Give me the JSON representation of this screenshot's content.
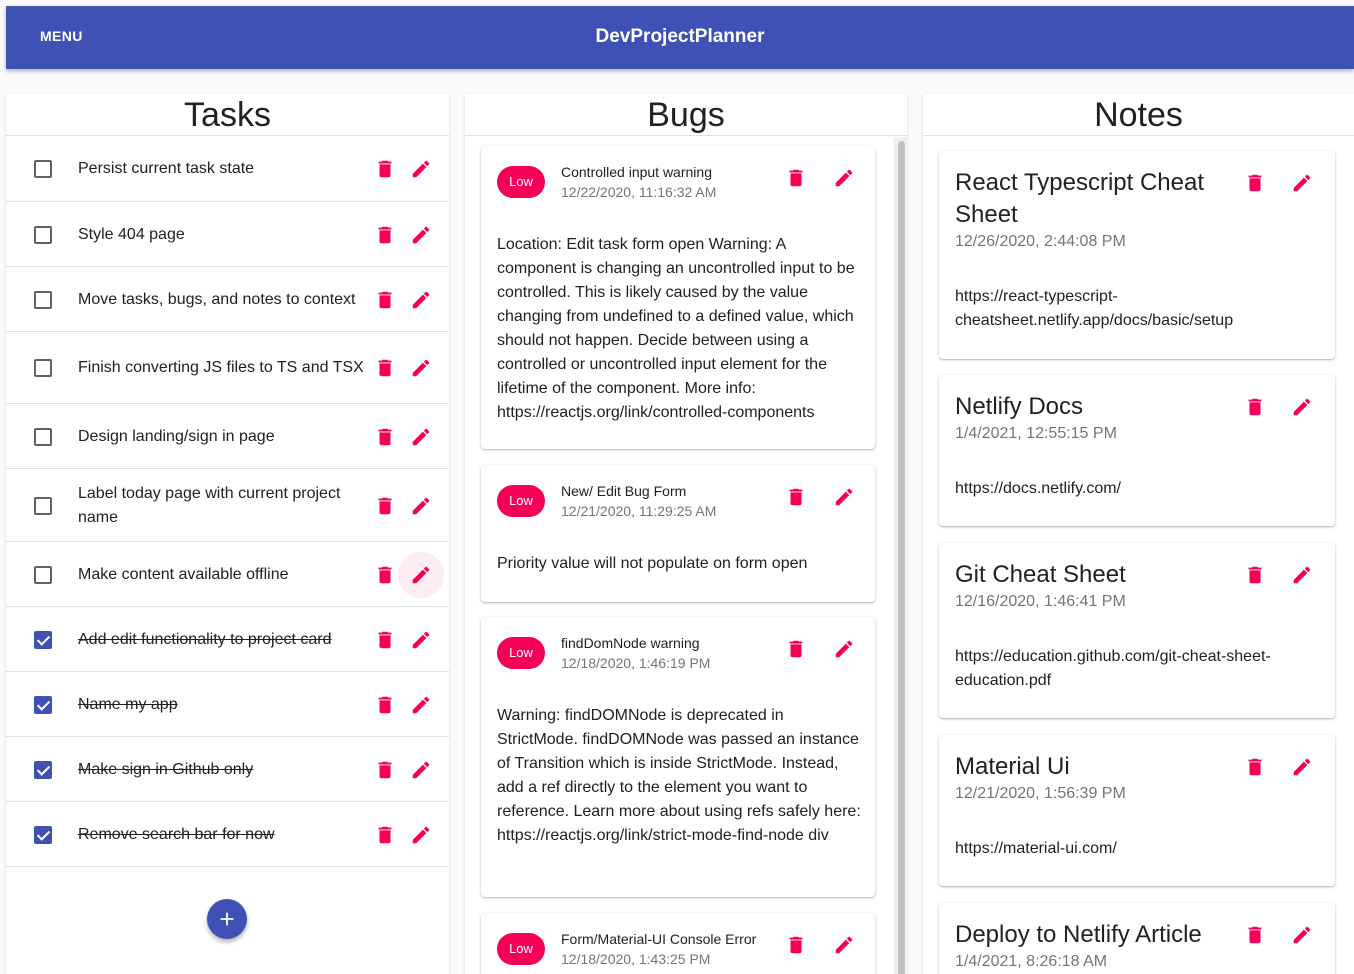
{
  "app": {
    "menu_label": "MENU",
    "title": "DevProjectPlanner"
  },
  "colors": {
    "primary": "#3f51b5",
    "secondary": "#f50057"
  },
  "tasks": {
    "title": "Tasks",
    "items": [
      {
        "text": "Persist current task state",
        "done": false
      },
      {
        "text": "Style 404 page",
        "done": false
      },
      {
        "text": "Move tasks, bugs, and notes to context",
        "done": false
      },
      {
        "text": "Finish converting JS files to TS and TSX",
        "done": false
      },
      {
        "text": "Design landing/sign in page",
        "done": false
      },
      {
        "text": "Label today page with current project name",
        "done": false
      },
      {
        "text": "Make content available offline",
        "done": false
      },
      {
        "text": "Add edit functionality to project card",
        "done": true
      },
      {
        "text": "Name my app",
        "done": true
      },
      {
        "text": "Make sign in Github only",
        "done": true
      },
      {
        "text": "Remove search bar for now",
        "done": true
      }
    ]
  },
  "bugs": {
    "title": "Bugs",
    "items": [
      {
        "priority": "Low",
        "title": "Controlled input warning",
        "date": "12/22/2020, 11:16:32 AM",
        "body": "Location: Edit task form open Warning: A component is changing an uncontrolled input to be controlled. This is likely caused by the value changing from undefined to a defined value, which should not happen. Decide between using a controlled or uncontrolled input element for the lifetime of the component. More info: https://reactjs.org/link/controlled-components"
      },
      {
        "priority": "Low",
        "title": "New/ Edit Bug Form",
        "date": "12/21/2020, 11:29:25 AM",
        "body": "Priority value will not populate on form open"
      },
      {
        "priority": "Low",
        "title": "findDomNode warning",
        "date": "12/18/2020, 1:46:19 PM",
        "body": "Warning: findDOMNode is deprecated in StrictMode. findDOMNode was passed an instance of Transition which is inside StrictMode. Instead, add a ref directly to the element you want to reference. Learn more about using refs safely here: https://reactjs.org/link/strict-mode-find-node div"
      },
      {
        "priority": "Low",
        "title": "Form/Material-UI Console Error",
        "date": "12/18/2020, 1:43:25 PM",
        "body": ""
      }
    ]
  },
  "notes": {
    "title": "Notes",
    "items": [
      {
        "title": "React Typescript Cheat Sheet",
        "date": "12/26/2020, 2:44:08 PM",
        "body": "https://react-typescript-cheatsheet.netlify.app/docs/basic/setup"
      },
      {
        "title": "Netlify Docs",
        "date": "1/4/2021, 12:55:15 PM",
        "body": "https://docs.netlify.com/"
      },
      {
        "title": "Git Cheat Sheet",
        "date": "12/16/2020, 1:46:41 PM",
        "body": "https://education.github.com/git-cheat-sheet-education.pdf"
      },
      {
        "title": "Material Ui",
        "date": "12/21/2020, 1:56:39 PM",
        "body": "https://material-ui.com/"
      },
      {
        "title": "Deploy to Netlify Article",
        "date": "1/4/2021, 8:26:18 AM",
        "body": ""
      }
    ]
  }
}
